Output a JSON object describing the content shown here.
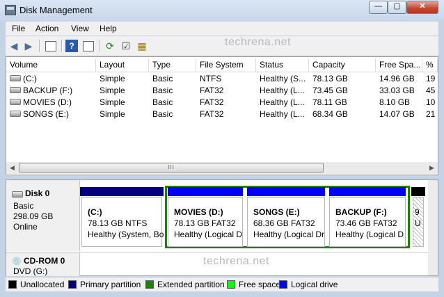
{
  "window": {
    "title": "Disk Management"
  },
  "menu": [
    "File",
    "Action",
    "View",
    "Help"
  ],
  "watermark": "techrena.net",
  "columns": [
    "Volume",
    "Layout",
    "Type",
    "File System",
    "Status",
    "Capacity",
    "Free Spa...",
    "%"
  ],
  "volumes": [
    [
      "(C:)",
      "Simple",
      "Basic",
      "NTFS",
      "Healthy (S...",
      "78.13 GB",
      "14.96 GB",
      "19"
    ],
    [
      "BACKUP (F:)",
      "Simple",
      "Basic",
      "FAT32",
      "Healthy (L...",
      "73.45 GB",
      "33.03 GB",
      "45"
    ],
    [
      "MOVIES (D:)",
      "Simple",
      "Basic",
      "FAT32",
      "Healthy (L...",
      "78.11 GB",
      "8.10 GB",
      "10"
    ],
    [
      "SONGS (E:)",
      "Simple",
      "Basic",
      "FAT32",
      "Healthy (L...",
      "68.34 GB",
      "14.07 GB",
      "21"
    ]
  ],
  "scroll_grip": "III",
  "disk0": {
    "name": "Disk 0",
    "type": "Basic",
    "size": "298.09 GB",
    "state": "Online",
    "partitions": [
      {
        "name": "(C:)",
        "detail": "78.13 GB NTFS",
        "status": "Healthy (System, Bo",
        "bar_color": "#000080"
      },
      {
        "name": "MOVIES  (D:)",
        "detail": "78.13 GB FAT32",
        "status": "Healthy (Logical D",
        "bar_color": "#0000ff"
      },
      {
        "name": "SONGS  (E:)",
        "detail": "68.36 GB FAT32",
        "status": "Healthy (Logical Dr",
        "bar_color": "#0000ff"
      },
      {
        "name": "BACKUP  (F:)",
        "detail": "73.46 GB FAT32",
        "status": "Healthy (Logical D",
        "bar_color": "#0000ff"
      },
      {
        "name": "9",
        "detail": "U",
        "status": "",
        "bar_color": "#000000"
      }
    ]
  },
  "cdrom": {
    "name": "CD-ROM 0",
    "detail": "DVD (G:)"
  },
  "legend": [
    {
      "label": "Unallocated",
      "color": "#000000"
    },
    {
      "label": "Primary partition",
      "color": "#000080"
    },
    {
      "label": "Extended partition",
      "color": "#208000"
    },
    {
      "label": "Free space",
      "color": "#00ff00"
    },
    {
      "label": "Logical drive",
      "color": "#0000ff"
    }
  ]
}
